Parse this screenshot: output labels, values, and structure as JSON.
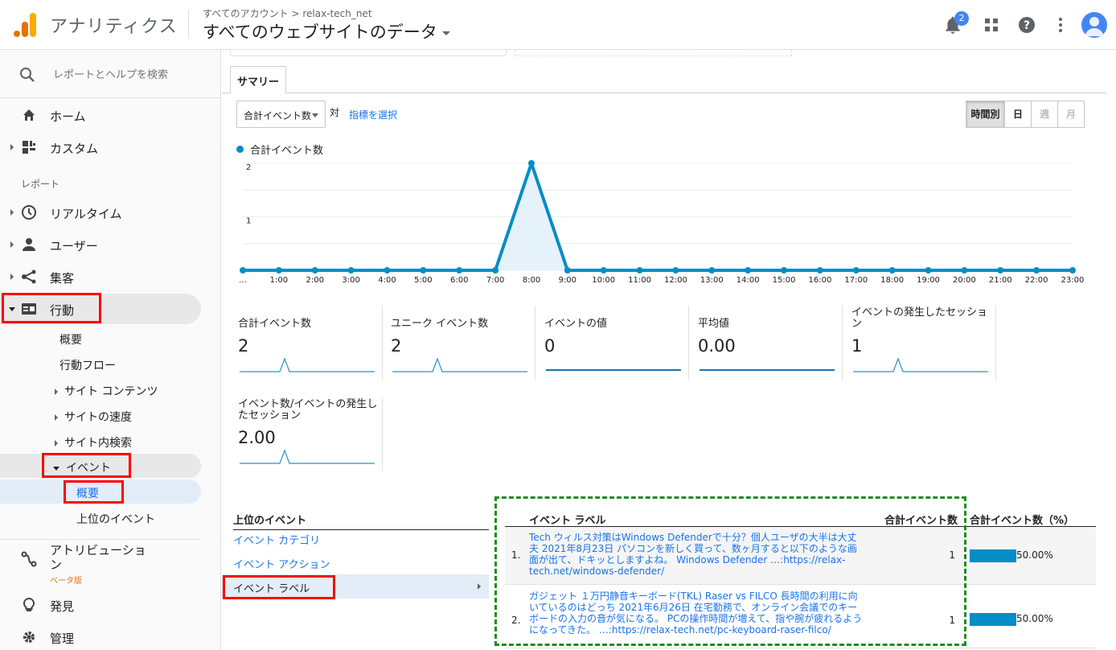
{
  "header": {
    "app_title": "アナリティクス",
    "breadcrumb": "すべてのアカウント > relax-tech_net",
    "property": "すべてのウェブサイトのデータ",
    "notification_count": "2"
  },
  "sidebar": {
    "search_placeholder": "レポートとヘルプを検索",
    "home": "ホーム",
    "custom": "カスタム",
    "reports_section": "レポート",
    "realtime": "リアルタイム",
    "users": "ユーザー",
    "acquisition": "集客",
    "behavior": "行動",
    "behavior_children": {
      "overview": "概要",
      "flow": "行動フロー",
      "site_content": "サイト コンテンツ",
      "site_speed": "サイトの速度",
      "site_search": "サイト内検索",
      "events": "イベント",
      "events_overview": "概要",
      "top_events": "上位のイベント"
    },
    "attribution": "アトリビューション",
    "beta": "ベータ版",
    "discover": "発見",
    "admin": "管理"
  },
  "main": {
    "tab": "サマリー",
    "metric_select": "合計イベント数",
    "vs": "対",
    "pick_metric": "指標を選択",
    "periods": [
      {
        "label": "時間別",
        "state": "on"
      },
      {
        "label": "日",
        "state": "normal"
      },
      {
        "label": "週",
        "state": "off"
      },
      {
        "label": "月",
        "state": "off"
      }
    ],
    "legend": "合計イベント数"
  },
  "chart_data": {
    "type": "area",
    "series": [
      {
        "name": "合計イベント数",
        "values": [
          0,
          0,
          0,
          0,
          0,
          0,
          0,
          0,
          2,
          0,
          0,
          0,
          0,
          0,
          0,
          0,
          0,
          0,
          0,
          0,
          0,
          0,
          0,
          0
        ]
      }
    ],
    "x": [
      "…",
      "1:00",
      "2:00",
      "3:00",
      "4:00",
      "5:00",
      "6:00",
      "7:00",
      "8:00",
      "9:00",
      "10:00",
      "11:00",
      "12:00",
      "13:00",
      "14:00",
      "15:00",
      "16:00",
      "17:00",
      "18:00",
      "19:00",
      "20:00",
      "21:00",
      "22:00",
      "23:00"
    ],
    "y_ticks": [
      "2",
      "1"
    ],
    "ylim": [
      0,
      2
    ],
    "color": "#058dc7"
  },
  "metrics": [
    {
      "label": "合計イベント数",
      "value": "2",
      "spark": "peak"
    },
    {
      "label": "ユニーク イベント数",
      "value": "2",
      "spark": "peak"
    },
    {
      "label": "イベントの値",
      "value": "0",
      "spark": "flat"
    },
    {
      "label": "平均値",
      "value": "0.00",
      "spark": "flat"
    },
    {
      "label": "イベントの発生したセッション",
      "value": "1",
      "spark": "peak"
    },
    {
      "label": "イベント数/イベントの発生したセッション",
      "value": "2.00",
      "spark": "peak"
    }
  ],
  "top_events": {
    "title": "上位のイベント",
    "links": [
      "イベント カテゴリ",
      "イベント アクション",
      "イベント ラベル"
    ]
  },
  "table": {
    "col_label": "イベント ラベル",
    "col_count": "合計イベント数",
    "col_pct": "合計イベント数（%）",
    "rows": [
      {
        "num": "1.",
        "label": "Tech ウィルス対策はWindows Defenderで十分？個人ユーザの大半は大丈夫 2021年8月23日 パソコンを新しく買って、数ヶ月すると以下のような画面が出て、ドキッとしますよね。 Windows Defender …:https://relax-tech.net/windows-defender/",
        "count": "1",
        "share": 0.5,
        "pct": "50.00%"
      },
      {
        "num": "2.",
        "label": "ガジェット １万円静音キーボード(TKL) Raser vs FILCO 長時間の利用に向いているのはどっち 2021年6月26日 在宅勤務で、オンライン会議でのキーボードの入力の音が気になる。 PCの操作時間が増えて、指や腕が疲れるようになってきた。 …:https://relax-tech.net/pc-keyboard-raser-filco/",
        "count": "1",
        "share": 0.5,
        "pct": "50.00%"
      }
    ]
  }
}
